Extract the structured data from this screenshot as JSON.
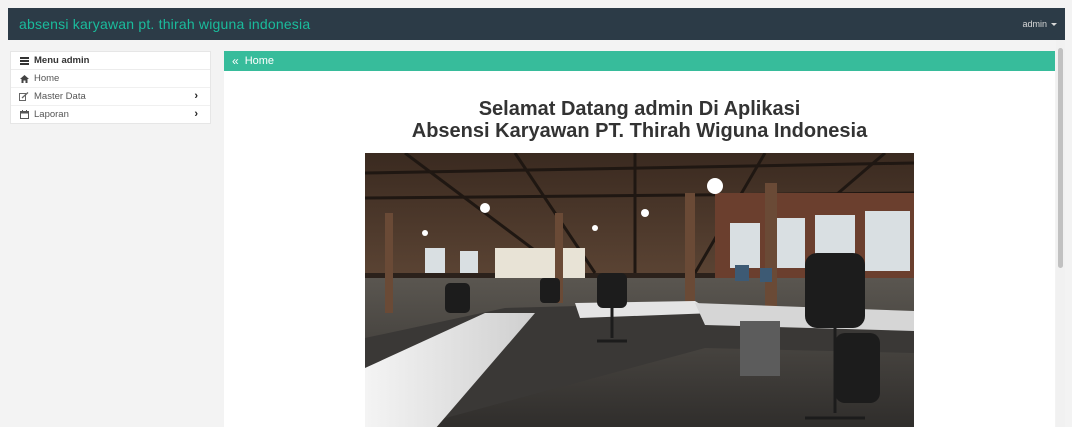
{
  "navbar": {
    "brand": "absensi karyawan pt. thirah wiguna indonesia",
    "user": "admin"
  },
  "sidebar": {
    "title": "Menu admin",
    "title_icon": "menu-icon",
    "items": [
      {
        "label": "Home",
        "icon": "home-icon",
        "submenu": false
      },
      {
        "label": "Master Data",
        "icon": "edit-icon",
        "submenu": true
      },
      {
        "label": "Laporan",
        "icon": "calendar-icon",
        "submenu": true
      }
    ]
  },
  "breadcrumb": {
    "label": "Home",
    "icon": "double-chevron-left-icon"
  },
  "welcome": {
    "line1": "Selamat Datang admin Di Aplikasi",
    "line2": "Absensi Karyawan PT. Thirah Wiguna Indonesia"
  },
  "colors": {
    "navbar": "#2c3b47",
    "brand": "#1abc9c",
    "accent": "#37bc9b"
  }
}
